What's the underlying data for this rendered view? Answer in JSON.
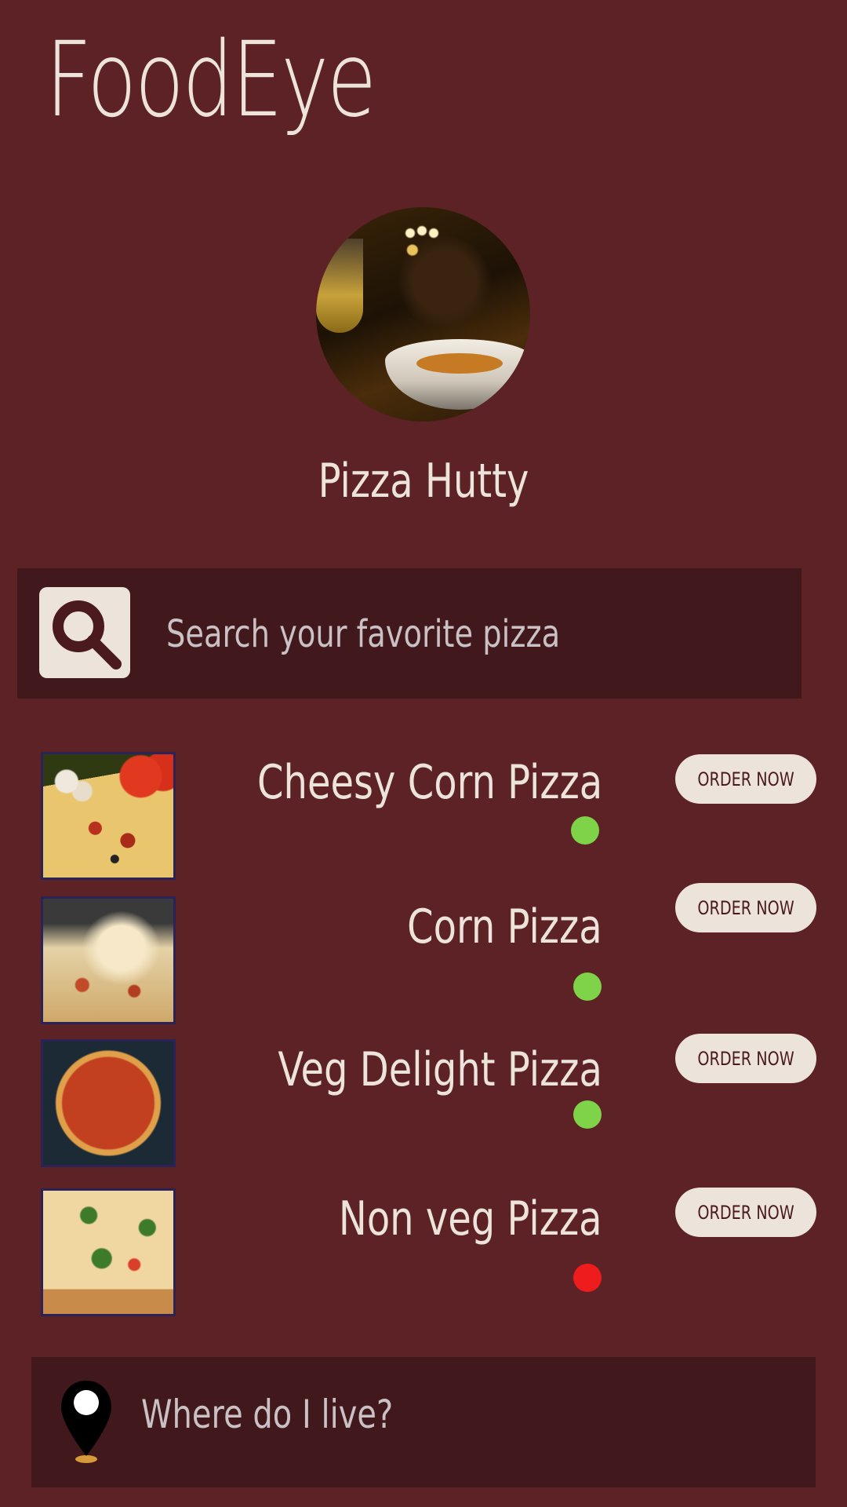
{
  "app": {
    "title": "FoodEye"
  },
  "restaurant": {
    "name": "Pizza Hutty"
  },
  "search": {
    "placeholder": "Search your favorite pizza"
  },
  "menu": {
    "items": [
      {
        "name": "Cheesy Corn Pizza",
        "status_color": "#7ed348",
        "button": "ORDER NOW",
        "image": "pizza-with-tomatoes-photo"
      },
      {
        "name": "Corn Pizza",
        "status_color": "#7ed348",
        "button": "ORDER NOW",
        "image": "cheese-pull-pizza-photo"
      },
      {
        "name": "Veg Delight Pizza",
        "status_color": "#7ed348",
        "button": "ORDER NOW",
        "image": "sliced-pizza-photo"
      },
      {
        "name": "Non veg Pizza",
        "status_color": "#ee1c1c",
        "button": "ORDER NOW",
        "image": "margherita-pizza-photo"
      }
    ]
  },
  "location": {
    "prompt": "Where do I live?",
    "icon": "map-pin-icon"
  },
  "colors": {
    "background": "#5c2226",
    "panel": "#41181b",
    "text": "#ece3da",
    "veg": "#7ed348",
    "nonveg": "#ee1c1c"
  }
}
